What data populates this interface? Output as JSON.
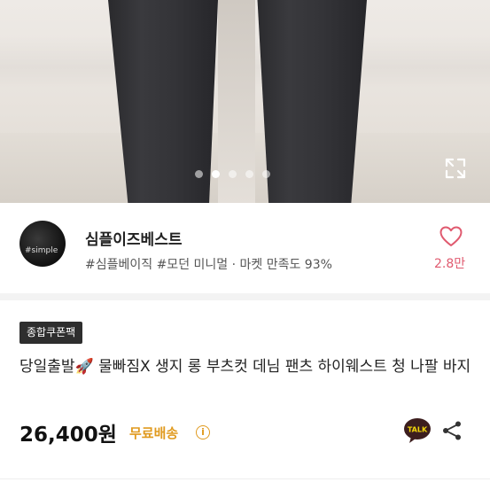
{
  "gallery": {
    "total_images": 5,
    "active_index": 2,
    "expand_icon": "expand-icon"
  },
  "seller": {
    "name": "심플이즈베스트",
    "avatar_text": "#simple",
    "tags": "#심플베이직 #모던 미니멀 · 마켓 만족도 93%",
    "like_count": "2.8만",
    "like_icon": "heart-icon",
    "accent_color": "#e05a6f"
  },
  "product": {
    "badge": "종합쿠폰팩",
    "title_prefix": "당일출발",
    "title_emoji": "🚀",
    "title_rest": " 물빠짐X 생지 롱 부츠컷 데님 팬츠 하이웨스트 청 나팔 바지",
    "price": "26,400원",
    "shipping": "무료배송",
    "shipping_color": "#e09a1f",
    "info_symbol": "i",
    "talk_label": "TALK",
    "share_icon": "share-icon"
  }
}
